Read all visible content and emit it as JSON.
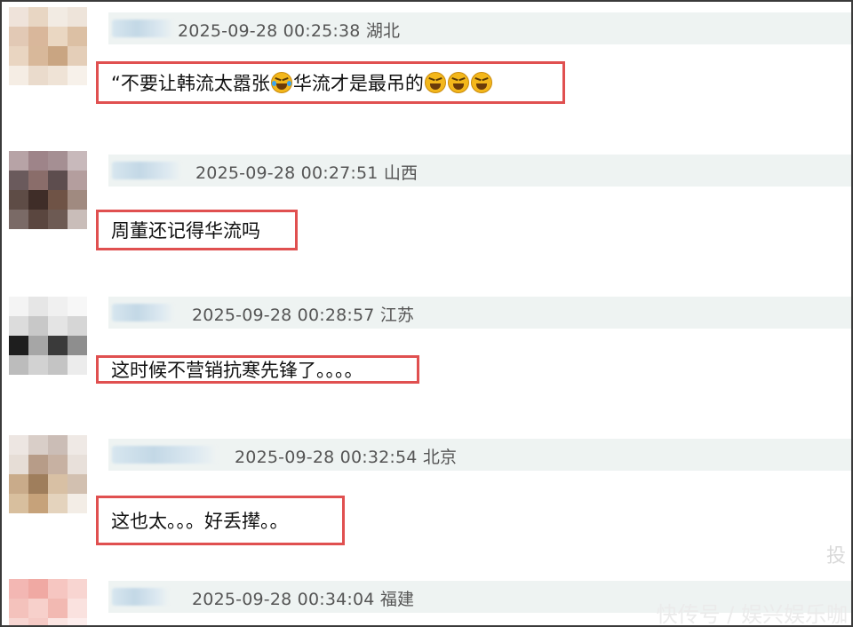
{
  "comments": [
    {
      "timestamp": "2025-09-28 00:25:38",
      "location": "湖北",
      "text_before": "“不要让韩流太嚣张",
      "emoji_mid": "laugh-cry-emoji",
      "text_after": "华流才是最吊的",
      "emoji_tail": [
        "grin-squint-emoji",
        "grin-squint-emoji",
        "grin-squint-emoji"
      ]
    },
    {
      "timestamp": "2025-09-28 00:27:51",
      "location": "山西",
      "text": "周董还记得华流吗"
    },
    {
      "timestamp": "2025-09-28 00:28:57",
      "location": "江苏",
      "text": "这时候不营销抗寒先锋了。。。。"
    },
    {
      "timestamp": "2025-09-28 00:32:54",
      "location": "北京",
      "text": "这也太。。。好丢撵。。"
    },
    {
      "timestamp": "2025-09-28 00:34:04",
      "location": "福建",
      "text": ""
    }
  ],
  "watermark": {
    "side": "投",
    "bottom": "快传号 / 娱兴娱乐咖"
  },
  "colors": {
    "highlight_border": "#e05050",
    "header_bg": "#eef3f2",
    "meta_text": "#555555"
  }
}
